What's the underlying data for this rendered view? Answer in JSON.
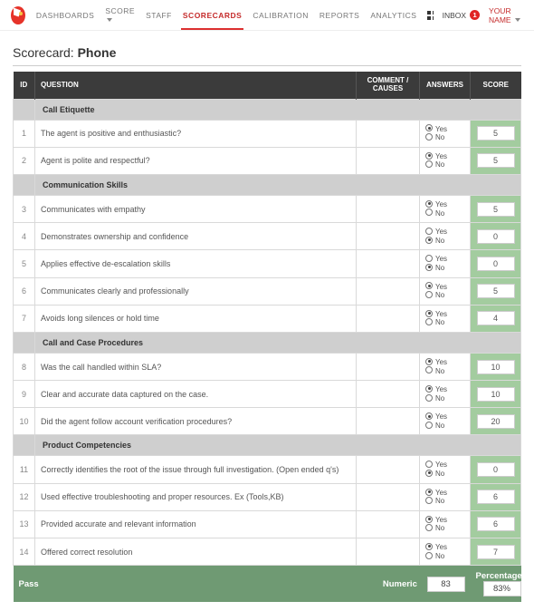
{
  "nav": {
    "items": [
      {
        "label": "DASHBOARDS",
        "active": false,
        "caret": false
      },
      {
        "label": "SCORE",
        "active": false,
        "caret": true
      },
      {
        "label": "STAFF",
        "active": false,
        "caret": false
      },
      {
        "label": "SCORECARDS",
        "active": true,
        "caret": false
      },
      {
        "label": "CALIBRATION",
        "active": false,
        "caret": false
      },
      {
        "label": "REPORTS",
        "active": false,
        "caret": false
      },
      {
        "label": "ANALYTICS",
        "active": false,
        "caret": false
      }
    ],
    "inbox_label": "INBOX",
    "inbox_count": "1",
    "user_name": "YOUR NAME"
  },
  "page": {
    "title_prefix": "Scorecard: ",
    "title_name": "Phone"
  },
  "headers": {
    "id": "ID",
    "question": "QUESTION",
    "comment": "COMMENT / CAUSES",
    "answers": "ANSWERS",
    "score": "SCORE"
  },
  "answer_labels": {
    "yes": "Yes",
    "no": "No"
  },
  "rows": [
    {
      "type": "section",
      "label": "Call Etiquette"
    },
    {
      "type": "q",
      "id": "1",
      "q": "The agent is positive and enthusiastic?",
      "sel": "yes",
      "score": "5"
    },
    {
      "type": "q",
      "id": "2",
      "q": "Agent is polite and respectful?",
      "sel": "yes",
      "score": "5"
    },
    {
      "type": "section",
      "label": "Communication Skills"
    },
    {
      "type": "q",
      "id": "3",
      "q": "Communicates with empathy",
      "sel": "yes",
      "score": "5"
    },
    {
      "type": "q",
      "id": "4",
      "q": "Demonstrates ownership and confidence",
      "sel": "no",
      "score": "0"
    },
    {
      "type": "q",
      "id": "5",
      "q": "Applies effective de-escalation skills",
      "sel": "no",
      "score": "0"
    },
    {
      "type": "q",
      "id": "6",
      "q": "Communicates clearly and professionally",
      "sel": "yes",
      "score": "5"
    },
    {
      "type": "q",
      "id": "7",
      "q": "Avoids long silences or hold time",
      "sel": "yes",
      "score": "4"
    },
    {
      "type": "section",
      "label": "Call and Case Procedures"
    },
    {
      "type": "q",
      "id": "8",
      "q": "Was the call handled within SLA?",
      "sel": "yes",
      "score": "10"
    },
    {
      "type": "q",
      "id": "9",
      "q": "Clear and accurate data captured on the case.",
      "sel": "yes",
      "score": "10"
    },
    {
      "type": "q",
      "id": "10",
      "q": "Did the agent follow account verification procedures?",
      "sel": "yes",
      "score": "20"
    },
    {
      "type": "section",
      "label": "Product Competencies"
    },
    {
      "type": "q",
      "id": "11",
      "q": "Correctly identifies the root of the issue through full investigation. (Open ended q's)",
      "sel": "no",
      "score": "0"
    },
    {
      "type": "q",
      "id": "12",
      "q": "Used effective troubleshooting and proper resources. Ex (Tools,KB)",
      "sel": "yes",
      "score": "6"
    },
    {
      "type": "q",
      "id": "13",
      "q": "Provided accurate and relevant information",
      "sel": "yes",
      "score": "6"
    },
    {
      "type": "q",
      "id": "14",
      "q": "Offered correct  resolution",
      "sel": "yes",
      "score": "7"
    }
  ],
  "footer": {
    "status_label": "Pass",
    "numeric_label": "Numeric",
    "numeric_value": "83",
    "percentage_label": "Percentage",
    "percentage_value": "83%"
  }
}
